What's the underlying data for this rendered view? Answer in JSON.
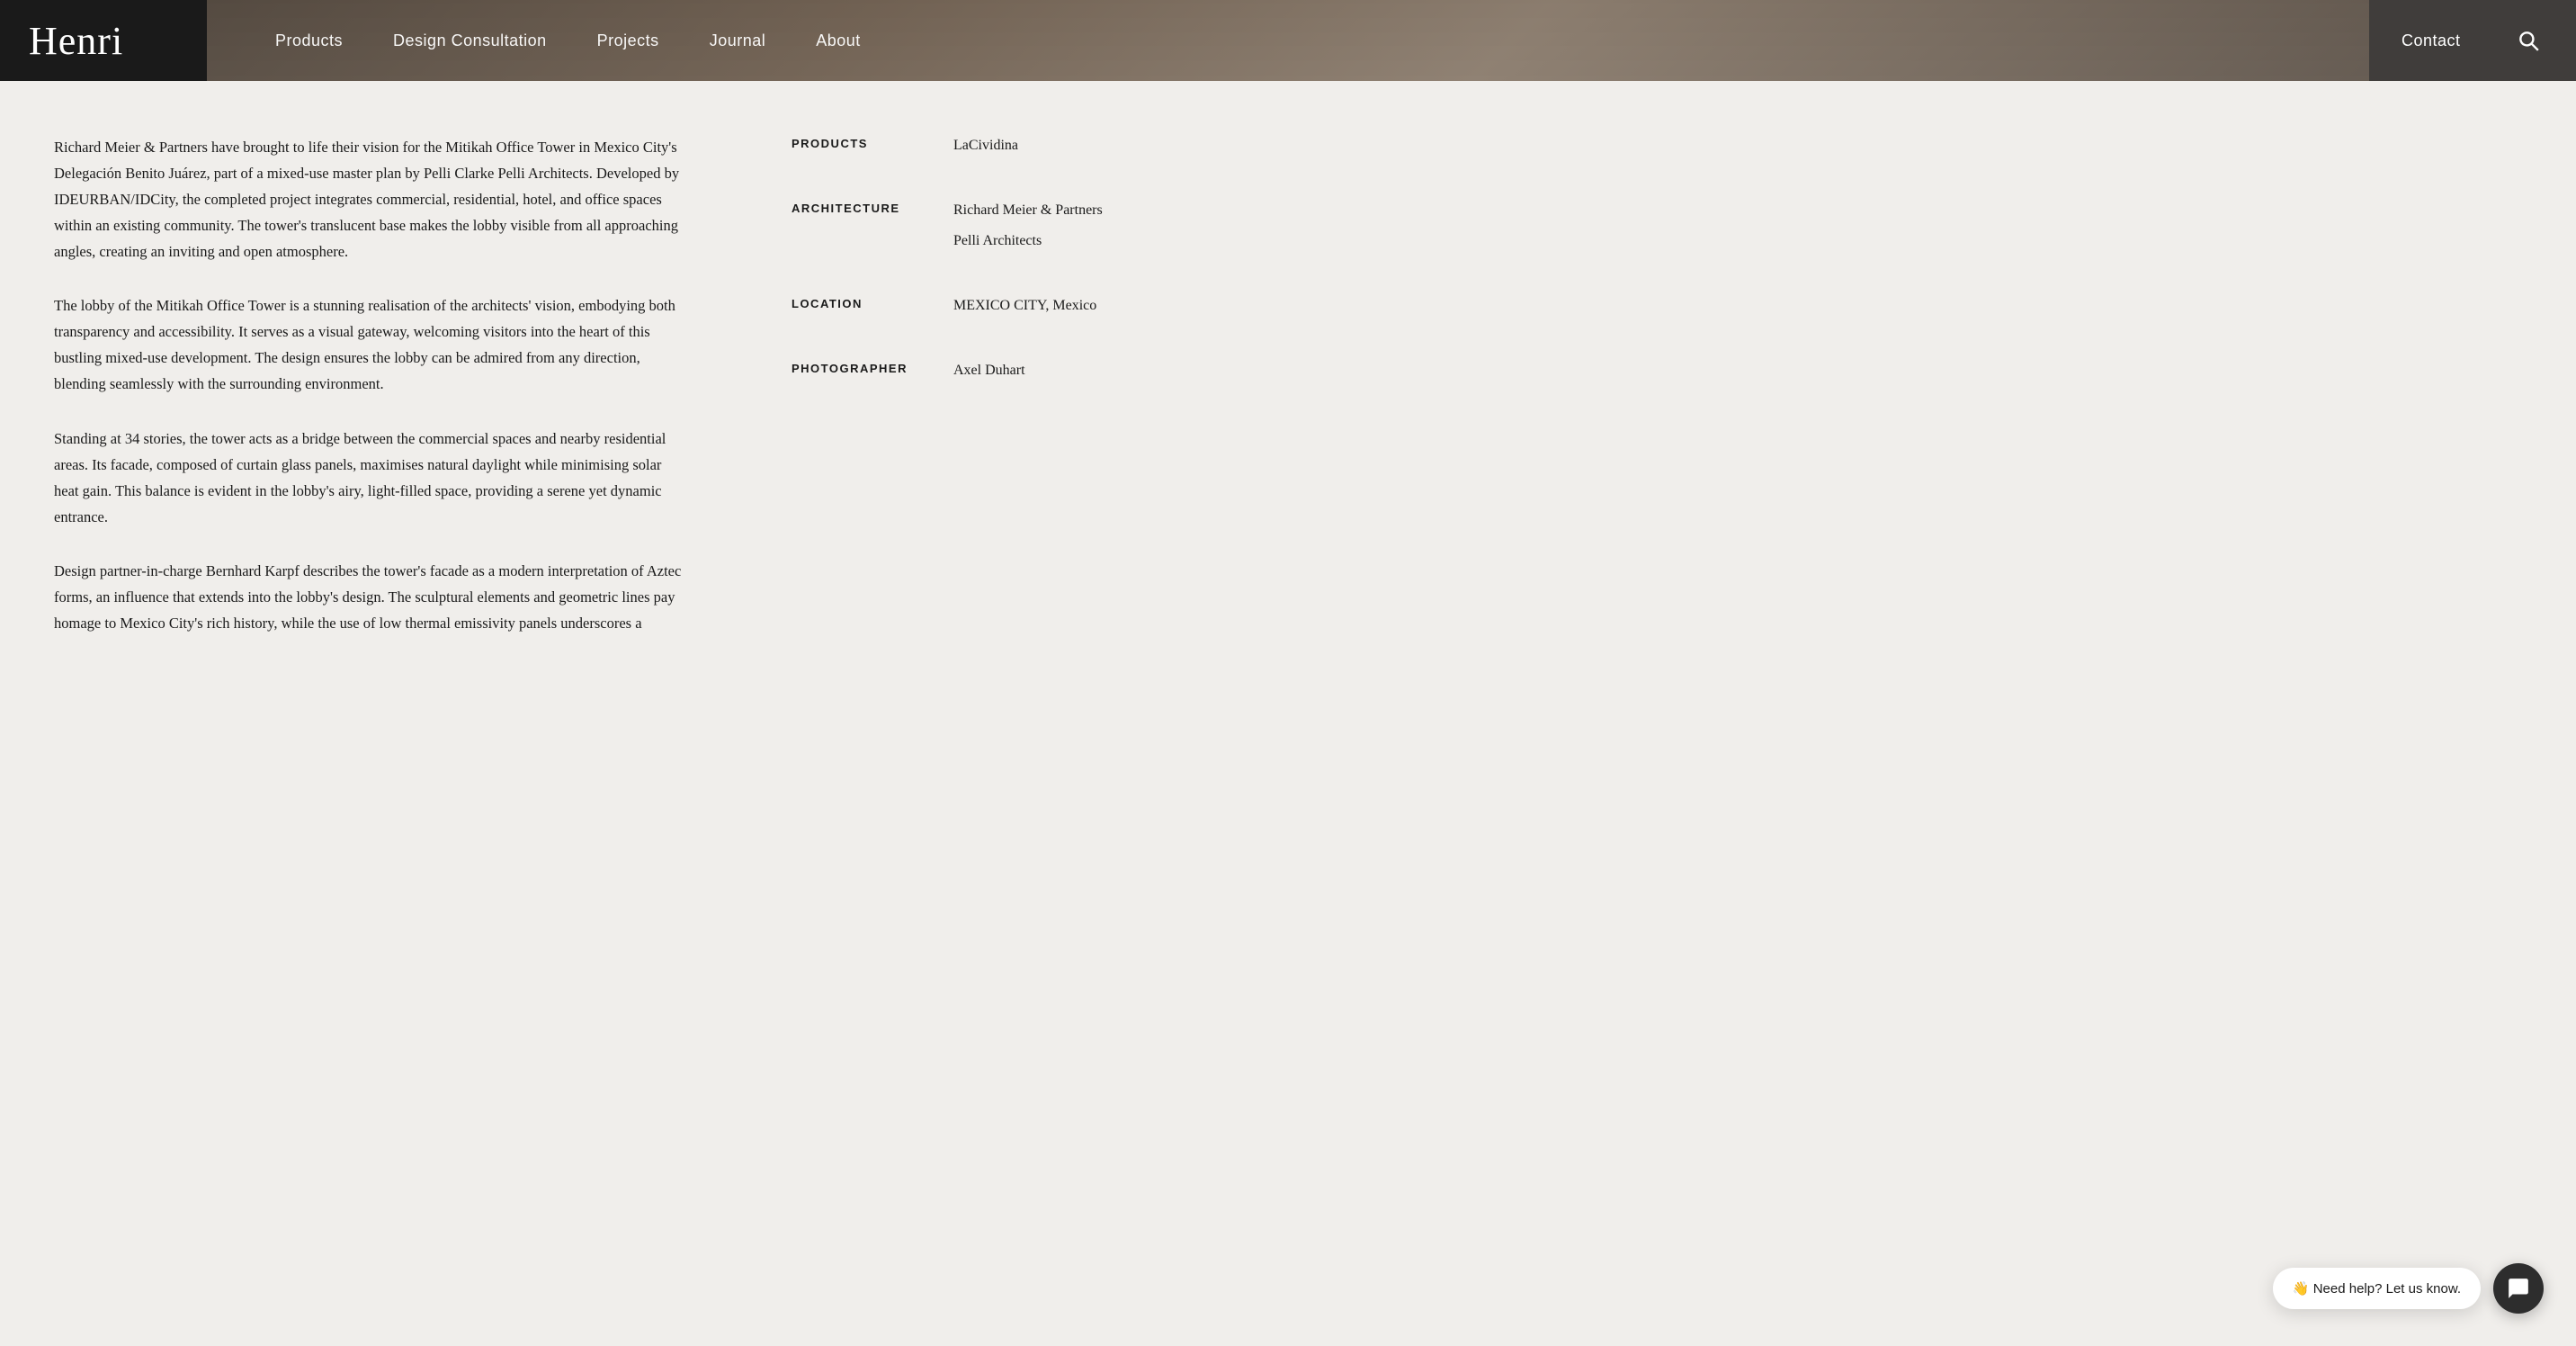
{
  "header": {
    "logo": "Henri",
    "nav": {
      "items": [
        {
          "label": "Products",
          "id": "products"
        },
        {
          "label": "Design Consultation",
          "id": "design-consultation"
        },
        {
          "label": "Projects",
          "id": "projects"
        },
        {
          "label": "Journal",
          "id": "journal"
        },
        {
          "label": "About",
          "id": "about"
        }
      ]
    },
    "contact_label": "Contact",
    "search_aria": "Search"
  },
  "article": {
    "paragraphs": [
      "Richard Meier & Partners have brought to life their vision for the Mitikah Office Tower in Mexico City's Delegación Benito Juárez, part of a mixed-use master plan by Pelli Clarke Pelli Architects. Developed by IDEURBAN/IDCity, the completed project integrates commercial, residential, hotel, and office spaces within an existing community. The tower's translucent base makes the lobby visible from all approaching angles, creating an inviting and open atmosphere.",
      "The lobby of the Mitikah Office Tower is a stunning realisation of the architects' vision, embodying both transparency and accessibility. It serves as a visual gateway, welcoming visitors into the heart of this bustling mixed-use development. The design ensures the lobby can be admired from any direction, blending seamlessly with the surrounding environment.",
      "Standing at 34 stories, the tower acts as a bridge between the commercial spaces and nearby residential areas. Its facade, composed of curtain glass panels, maximises natural daylight while minimising solar heat gain. This balance is evident in the lobby's airy, light-filled space, providing a serene yet dynamic entrance.",
      "Design partner-in-charge Bernhard Karpf describes the tower's facade as a modern interpretation of Aztec forms, an influence that extends into the lobby's design. The sculptural elements and geometric lines pay homage to Mexico City's rich history, while the use of low thermal emissivity panels underscores a"
    ]
  },
  "sidebar": {
    "rows": [
      {
        "label": "PRODUCTS",
        "values": [
          "LaCividina"
        ]
      },
      {
        "label": "ARCHITECTURE",
        "values": [
          "Richard Meier & Partners",
          "Pelli Architects"
        ]
      },
      {
        "label": "LOCATION",
        "values": [
          "MEXICO CITY, Mexico"
        ]
      },
      {
        "label": "PHOTOGRAPHER",
        "values": [
          "Axel Duhart"
        ]
      }
    ]
  },
  "chat": {
    "bubble_text": "👋 Need help? Let us know.",
    "button_aria": "Open chat"
  }
}
